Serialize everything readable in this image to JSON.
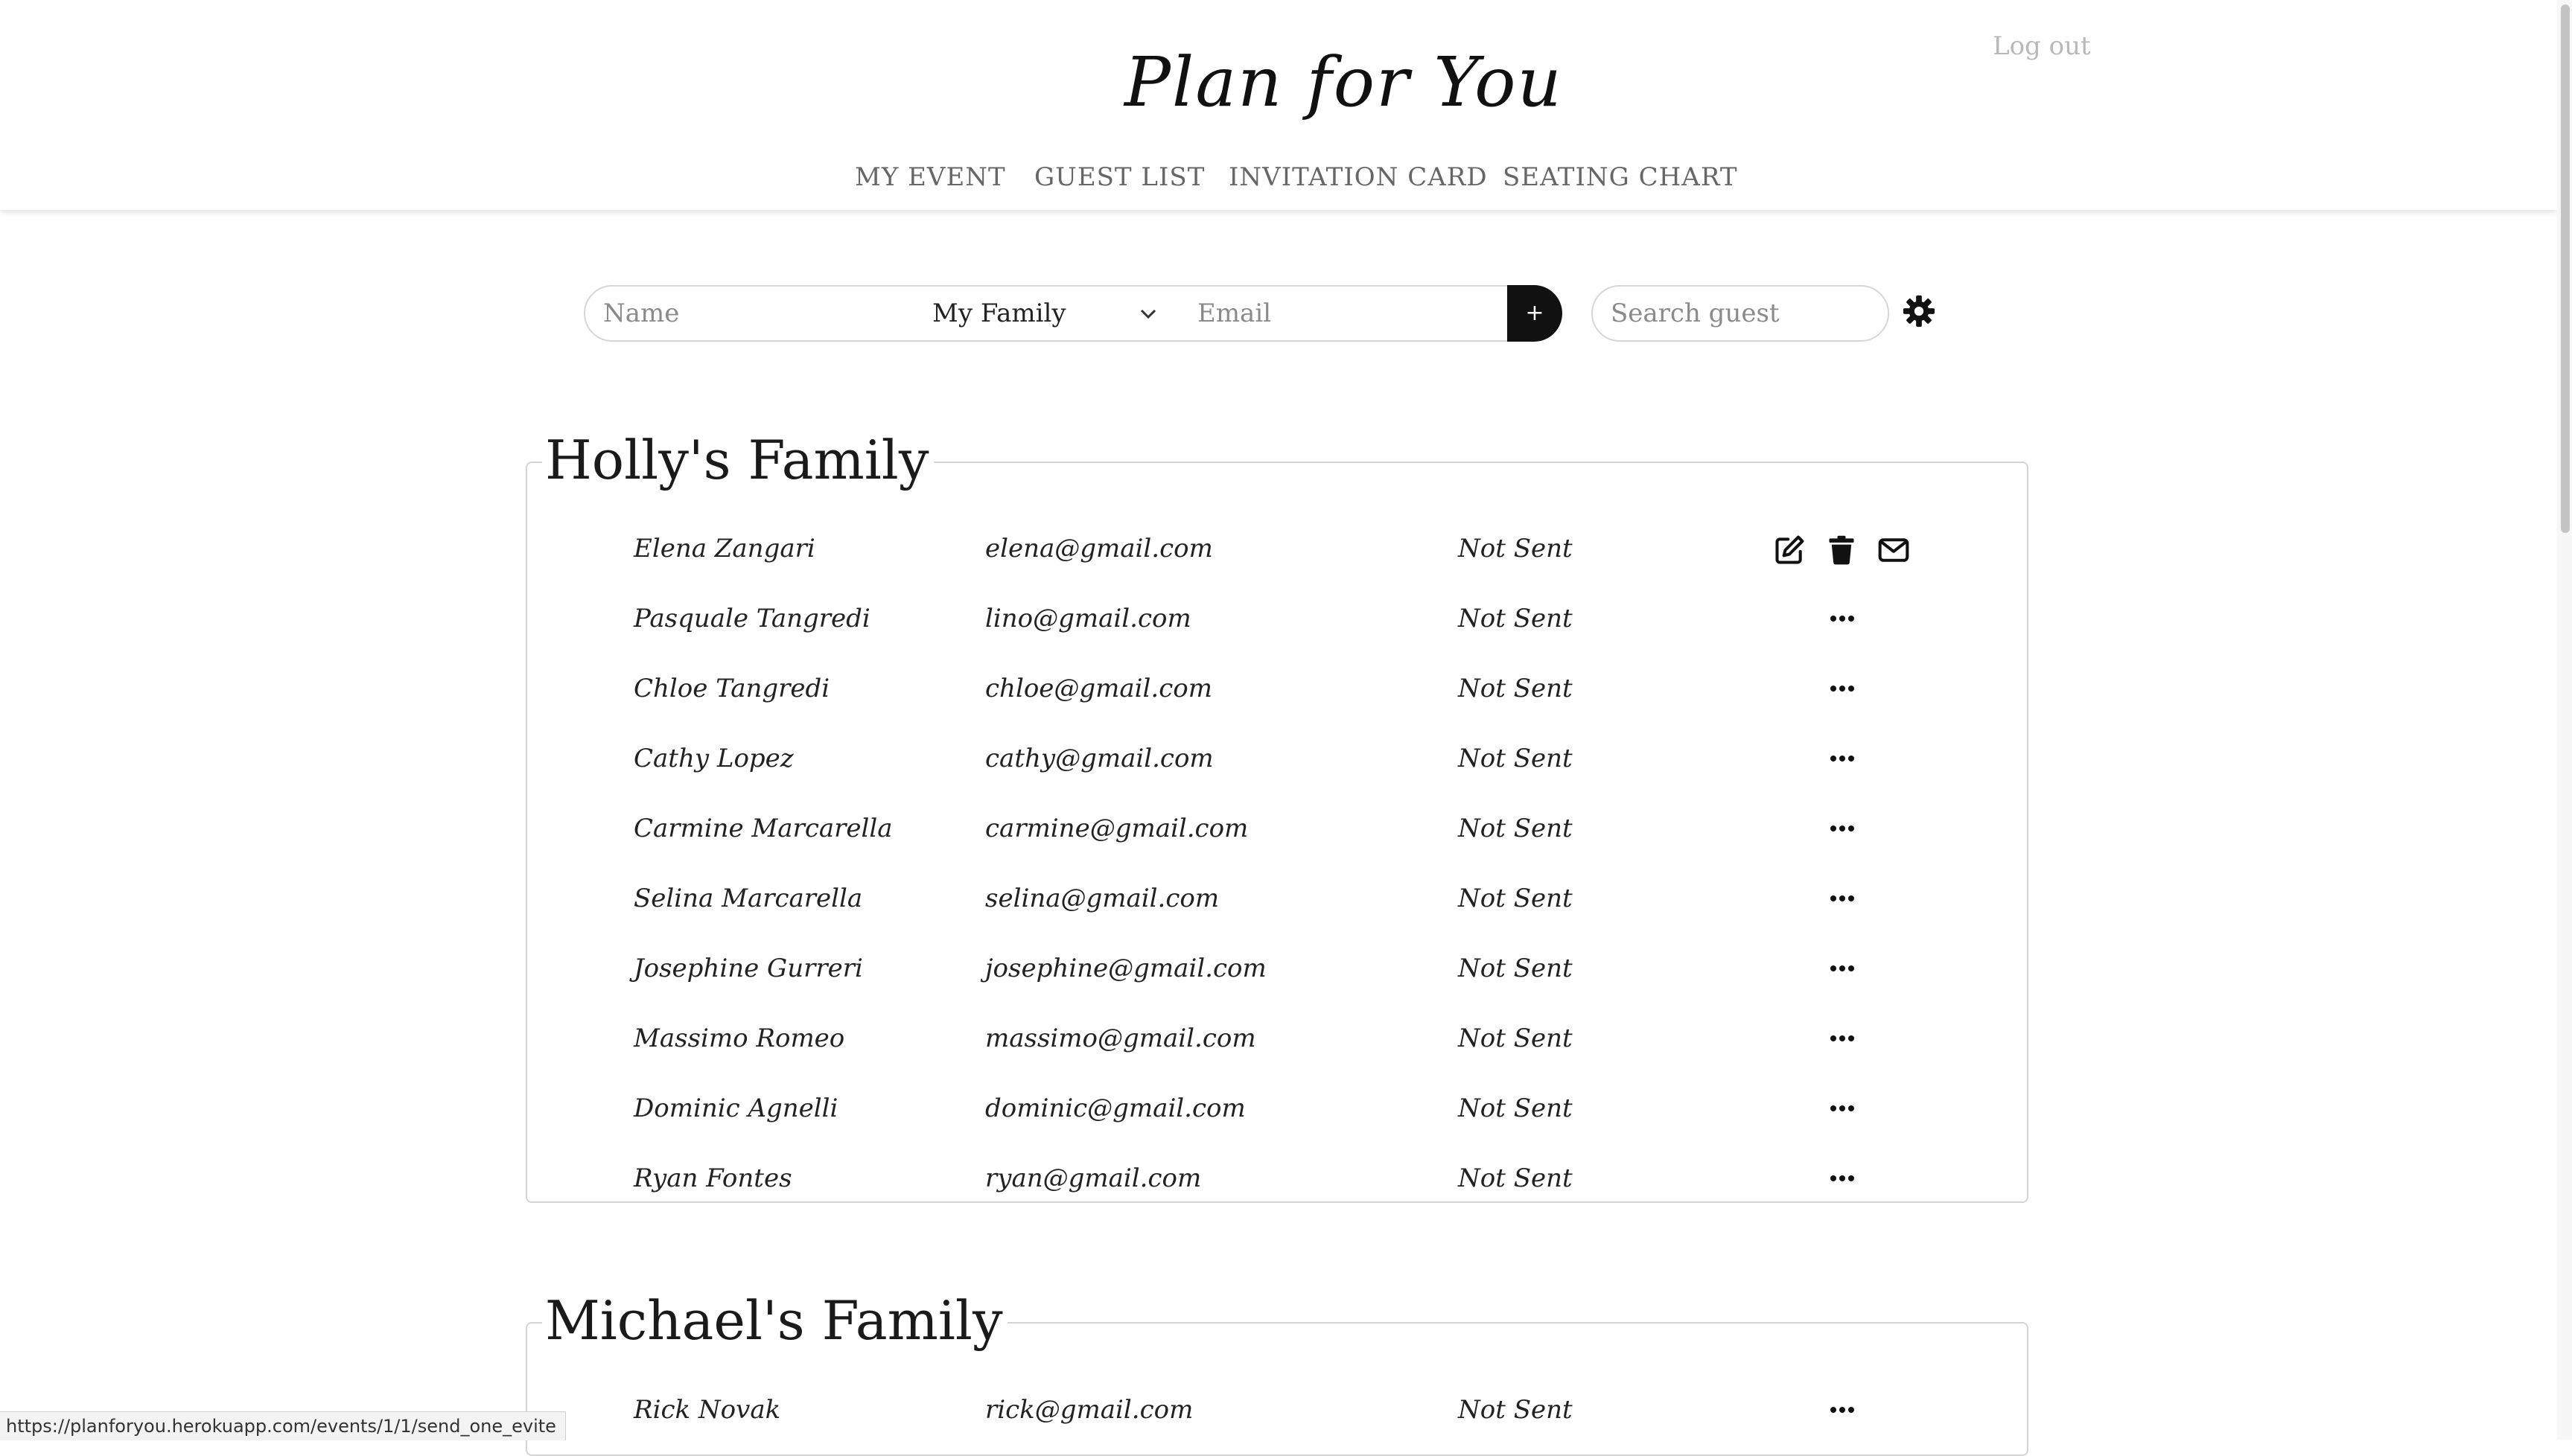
{
  "header": {
    "logo": "Plan for You",
    "logout": "Log out",
    "nav": [
      "MY EVENT",
      "GUEST LIST",
      "INVITATION CARD",
      "SEATING CHART"
    ]
  },
  "add_form": {
    "name_placeholder": "Name",
    "group_selected": "My Family",
    "email_placeholder": "Email",
    "add_label": "+"
  },
  "search": {
    "placeholder": "Search guest"
  },
  "groups": [
    {
      "title": "Holly's Family",
      "guests": [
        {
          "name": "Elena Zangari",
          "email": "elena@gmail.com",
          "status": "Not Sent"
        },
        {
          "name": "Pasquale Tangredi",
          "email": "lino@gmail.com",
          "status": "Not Sent"
        },
        {
          "name": "Chloe Tangredi",
          "email": "chloe@gmail.com",
          "status": "Not Sent"
        },
        {
          "name": "Cathy Lopez",
          "email": "cathy@gmail.com",
          "status": "Not Sent"
        },
        {
          "name": "Carmine Marcarella",
          "email": "carmine@gmail.com",
          "status": "Not Sent"
        },
        {
          "name": "Selina Marcarella",
          "email": "selina@gmail.com",
          "status": "Not Sent"
        },
        {
          "name": "Josephine Gurreri",
          "email": "josephine@gmail.com",
          "status": "Not Sent"
        },
        {
          "name": "Massimo Romeo",
          "email": "massimo@gmail.com",
          "status": "Not Sent"
        },
        {
          "name": "Dominic Agnelli",
          "email": "dominic@gmail.com",
          "status": "Not Sent"
        },
        {
          "name": "Ryan Fontes",
          "email": "ryan@gmail.com",
          "status": "Not Sent"
        }
      ]
    },
    {
      "title": "Michael's Family",
      "guests": [
        {
          "name": "Rick Novak",
          "email": "rick@gmail.com",
          "status": "Not Sent"
        }
      ]
    }
  ],
  "row_actions": {
    "expanded_icons": [
      "edit-icon",
      "trash-icon",
      "mail-icon"
    ],
    "collapsed_icon": "more-icon"
  },
  "status_bar": "https://planforyou.herokuapp.com/events/1/1/send_one_evite",
  "colors": {
    "accent": "#111111",
    "border": "#d4d4d4",
    "muted": "#b8b8b8"
  }
}
